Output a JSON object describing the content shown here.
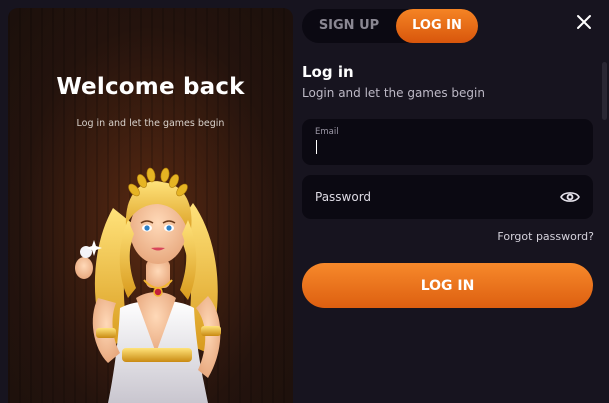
{
  "left_panel": {
    "title": "Welcome back",
    "subtitle": "Log in and let the games begin",
    "hero_icon": "goddess-holding-pearl-illustration"
  },
  "tabs": [
    {
      "label": "SIGN UP",
      "active": false
    },
    {
      "label": "LOG IN",
      "active": true
    }
  ],
  "close_icon": "close-x-icon",
  "form": {
    "title": "Log in",
    "subtitle": "Login and let the games begin",
    "email": {
      "label": "Email",
      "value": "",
      "placeholder": ""
    },
    "password": {
      "placeholder": "Password",
      "value": "",
      "icon": "eye-icon"
    },
    "forgot_link": "Forgot password?",
    "submit_label": "LOG IN"
  },
  "colors": {
    "background": "#17141f",
    "field_bg": "#0b0912",
    "accent_orange": "#f58424",
    "accent_orange_dark": "#d8560c"
  }
}
